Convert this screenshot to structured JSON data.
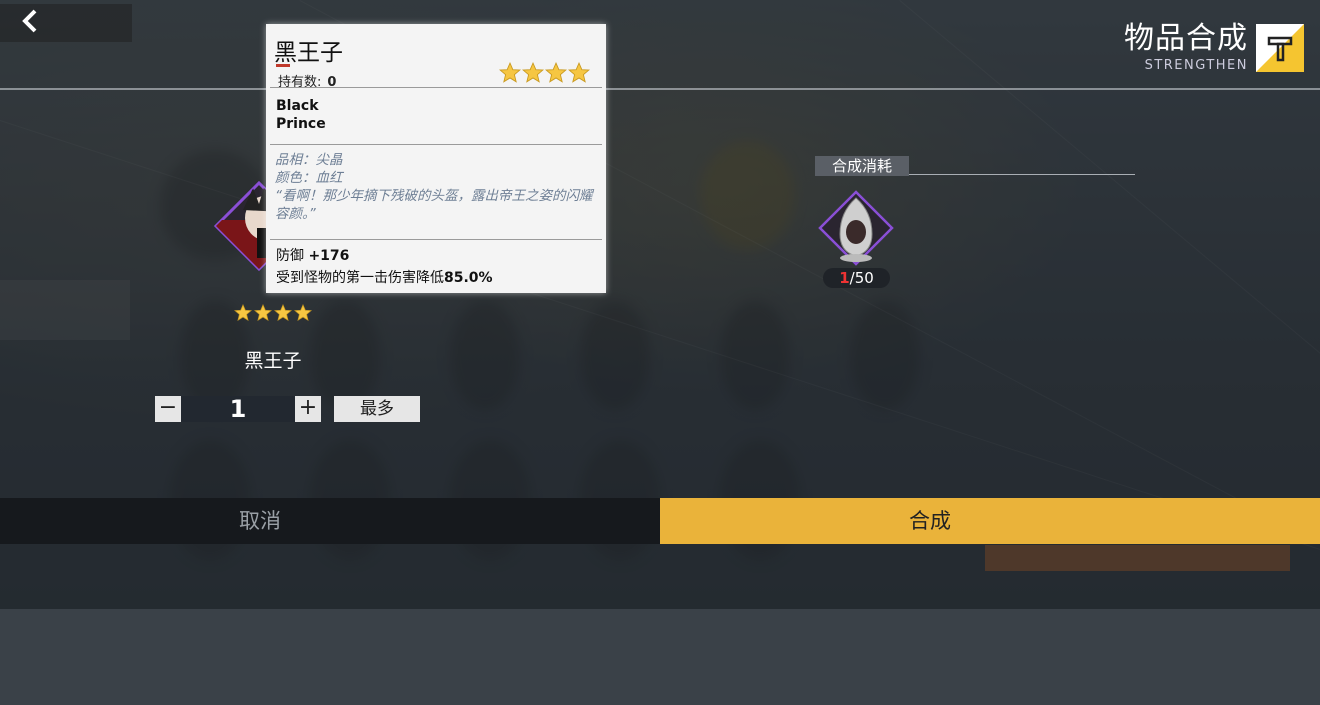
{
  "header": {
    "title": "物品合成",
    "subtitle": "STRENGTHEN",
    "back_icon": "chevron-left-icon",
    "title_icon": "hammer-icon"
  },
  "item": {
    "name": "黑王子",
    "rarity": 4,
    "quantity": "1",
    "minus_label": "−",
    "plus_label": "+",
    "max_label": "最多"
  },
  "tooltip": {
    "name": "黑王子",
    "owned_label": "持有数:",
    "owned_value": "0",
    "rarity": 4,
    "english_name": "Black\nPrince",
    "quality_line": "品相：尖晶",
    "color_line": "颜色：血红",
    "flavor_text": "“看啊！那少年摘下残破的头盔，露出帝王之姿的闪耀容颜。”",
    "stat1_label": "防御 ",
    "stat1_value": "+176",
    "stat2_label": "受到怪物的第一击伤害降低",
    "stat2_value": "85.0%"
  },
  "consume": {
    "label": "合成消耗",
    "have": "1",
    "need": "/50"
  },
  "actions": {
    "cancel_label": "取消",
    "craft_label": "合成"
  },
  "colors": {
    "accent": "#eab33a",
    "frame": "#8a4fd6",
    "star": "#f6c642",
    "count_red": "#e33333"
  }
}
